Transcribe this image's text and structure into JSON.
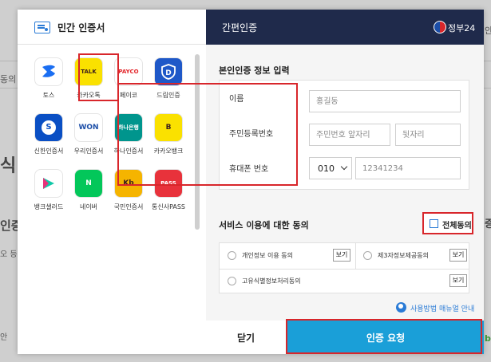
{
  "background": {
    "fragments": [
      "동의",
      "식",
      "인증",
      "오 등",
      "안",
      "안",
      "증",
      "b"
    ]
  },
  "left": {
    "title": "민간 인증서",
    "apps": [
      {
        "label": "토스",
        "icon": "toss-icon",
        "color": "#ffffff",
        "glyph": ""
      },
      {
        "label": "카카오톡",
        "icon": "kakaotalk-icon",
        "color": "#fae100",
        "glyph": "TALK"
      },
      {
        "label": "페이코",
        "icon": "payco-icon",
        "color": "#ffffff",
        "glyph": "PAYCO"
      },
      {
        "label": "드림인증",
        "icon": "dream-icon",
        "color": "#1f58c8",
        "glyph": "D"
      },
      {
        "label": "신한인증서",
        "icon": "shinhan-icon",
        "color": "#0a4fc4",
        "glyph": "S"
      },
      {
        "label": "우리인증서",
        "icon": "woori-icon",
        "color": "#ffffff",
        "glyph": "WON"
      },
      {
        "label": "하나인증서",
        "icon": "hana-icon",
        "color": "#00958d",
        "glyph": "하나은행"
      },
      {
        "label": "카카오뱅크",
        "icon": "kakaobank-icon",
        "color": "#fae100",
        "glyph": "B"
      },
      {
        "label": "뱅크샐러드",
        "icon": "banksalad-icon",
        "color": "#ffffff",
        "glyph": ""
      },
      {
        "label": "네이버",
        "icon": "naver-icon",
        "color": "#03c75a",
        "glyph": "N"
      },
      {
        "label": "국민인증서",
        "icon": "kb-icon",
        "color": "#f5b400",
        "glyph": "Kb"
      },
      {
        "label": "통신사PASS",
        "icon": "pass-icon",
        "color": "#e8323b",
        "glyph": "PASS"
      }
    ]
  },
  "right": {
    "title": "간편인증",
    "gov_label": "정부24",
    "section_identity": "본인인증 정보 입력",
    "form": {
      "name_label": "이름",
      "name_placeholder": "홍길동",
      "rrn_label": "주민등록번호",
      "rrn_front_placeholder": "주민번호 앞자리",
      "rrn_back_placeholder": "뒷자리",
      "phone_label": "휴대폰 번호",
      "carrier_value": "010",
      "phone_placeholder": "12341234"
    },
    "section_consent": "서비스 이용에 대한 동의",
    "agree_all_label": "전체동의",
    "agreements": [
      {
        "label": "개인정보 이용 동의",
        "view": "보기"
      },
      {
        "label": "제3자정보제공동의",
        "view": "보기"
      },
      {
        "label": "고유식별정보처리동의",
        "view": "보기"
      }
    ],
    "manual_link": "사용방법 매뉴얼 안내",
    "close_label": "닫기",
    "request_label": "인증 요청"
  }
}
